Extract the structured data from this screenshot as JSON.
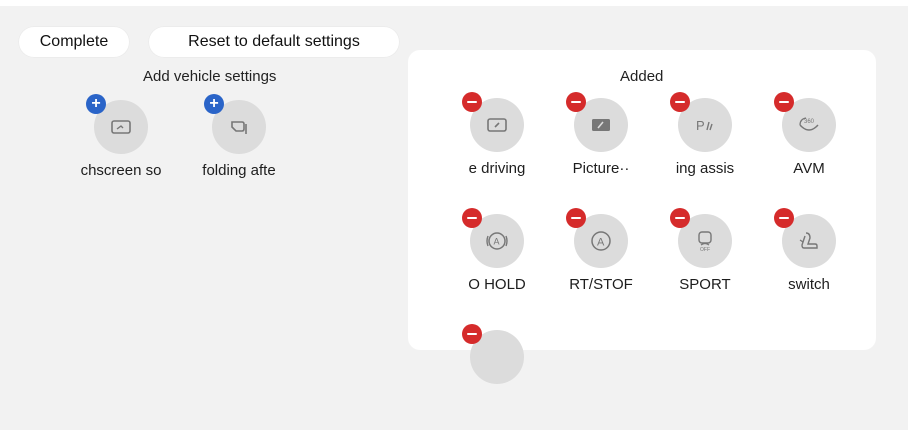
{
  "toolbar": {
    "complete_label": "Complete",
    "reset_label": "Reset to default settings"
  },
  "left_section": {
    "title": "Add vehicle settings",
    "items": [
      {
        "label": "chscreen so",
        "icon": "touchscreen-icon",
        "badge": "add"
      },
      {
        "label": "folding afte",
        "icon": "mirror-fold-icon",
        "badge": "add"
      }
    ]
  },
  "right_section": {
    "title": "Added",
    "items": [
      {
        "label": "e driving",
        "icon": "screen-off-icon",
        "badge": "remove"
      },
      {
        "label": "Picture··",
        "icon": "picture-icon",
        "badge": "remove"
      },
      {
        "label": "ing assis",
        "icon": "parking-assist-icon",
        "badge": "remove"
      },
      {
        "label": "AVM",
        "icon": "avm-360-icon",
        "badge": "remove"
      },
      {
        "label": "O HOLD",
        "icon": "auto-hold-icon",
        "badge": "remove"
      },
      {
        "label": "RT/STOF",
        "icon": "auto-start-stop-icon",
        "badge": "remove"
      },
      {
        "label": "SPORT",
        "icon": "esp-off-icon",
        "badge": "remove"
      },
      {
        "label": "switch",
        "icon": "seat-switch-icon",
        "badge": "remove"
      },
      {
        "label": "",
        "icon": "unknown-icon",
        "badge": "remove"
      }
    ]
  },
  "colors": {
    "add_badge": "#2a64c8",
    "remove_badge": "#d52b2b",
    "icon_disk": "#dcdcdc",
    "background": "#f2f2f2",
    "panel": "#ffffff"
  }
}
